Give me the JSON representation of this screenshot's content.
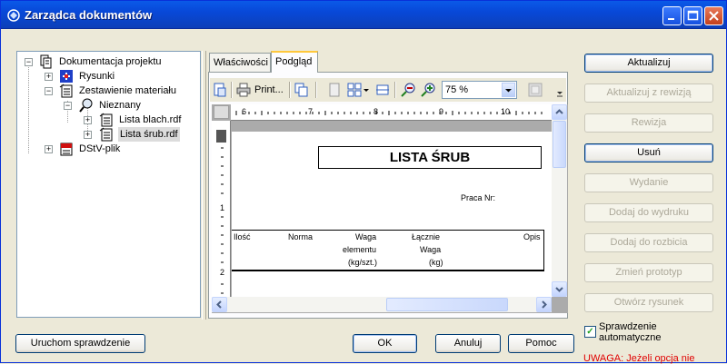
{
  "window": {
    "title": "Zarządca dokumentów"
  },
  "tree": {
    "root": "Dokumentacja projektu",
    "rysunki": "Rysunki",
    "zestawienie": "Zestawienie materiału",
    "nieznany": "Nieznany",
    "lista_blach": "Lista blach.rdf",
    "lista_srub": "Lista śrub.rdf",
    "dstv": "DStV-plik",
    "expand_plus": "+",
    "expand_minus": "−"
  },
  "tabs": {
    "properties": "Właściwości",
    "preview": "Podgląd"
  },
  "toolbar": {
    "print_label": "Print...",
    "zoom": "75 %"
  },
  "ruler": {
    "h_ticks": [
      "6",
      "7",
      "8",
      "9",
      "10"
    ],
    "v_ticks": [
      "1",
      "2"
    ]
  },
  "preview_page": {
    "title": "LISTA ŚRUB",
    "job_label": "Praca Nr:",
    "columns": {
      "qty": "Ilość",
      "norm": "Norma",
      "weight_line1": "Waga",
      "weight_line2": "elementu",
      "weight_line3": "(kg/szt.)",
      "total_line1": "Łącznie",
      "total_line2": "Waga",
      "total_line3": "(kg)",
      "desc": "Opis"
    }
  },
  "buttons": {
    "update": "Aktualizuj",
    "update_rev": "Aktualizuj z rewizją",
    "revision": "Rewizja",
    "delete": "Usuń",
    "issue": "Wydanie",
    "add_print": "Dodaj do wydruku",
    "add_split": "Dodaj do rozbicia",
    "change_proto": "Zmień prototyp",
    "open_drawing": "Otwórz rysunek",
    "run_check": "Uruchom sprawdzenie",
    "ok": "OK",
    "cancel": "Anuluj",
    "help": "Pomoc"
  },
  "auto_check": {
    "label": "Sprawdzenie automatyczne",
    "checked": true,
    "mark": "✓"
  },
  "warning": "UWAGA: Jeżeli opcja nie",
  "colors": {
    "title_bar": "#0a5ae8",
    "warning": "#e00000",
    "tab_highlight": "#ffc83c"
  }
}
